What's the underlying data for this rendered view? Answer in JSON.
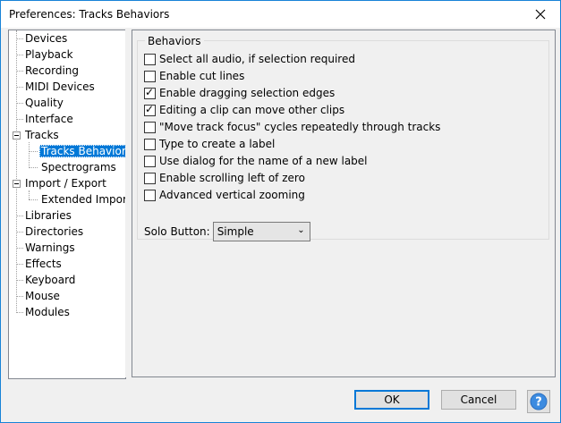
{
  "window": {
    "title": "Preferences: Tracks Behaviors",
    "close_icon": "close-icon"
  },
  "tree": {
    "items": [
      {
        "label": "Devices"
      },
      {
        "label": "Playback"
      },
      {
        "label": "Recording"
      },
      {
        "label": "MIDI Devices"
      },
      {
        "label": "Quality"
      },
      {
        "label": "Interface"
      },
      {
        "label": "Tracks"
      },
      {
        "label": "Tracks Behaviors"
      },
      {
        "label": "Spectrograms"
      },
      {
        "label": "Import / Export"
      },
      {
        "label": "Extended Import"
      },
      {
        "label": "Libraries"
      },
      {
        "label": "Directories"
      },
      {
        "label": "Warnings"
      },
      {
        "label": "Effects"
      },
      {
        "label": "Keyboard"
      },
      {
        "label": "Mouse"
      },
      {
        "label": "Modules"
      }
    ],
    "selected": "Tracks Behaviors"
  },
  "behaviors": {
    "group_title": "Behaviors",
    "options": [
      {
        "label": "Select all audio, if selection required",
        "checked": false
      },
      {
        "label": "Enable cut lines",
        "checked": false
      },
      {
        "label": "Enable dragging selection edges",
        "checked": true
      },
      {
        "label": "Editing a clip can move other clips",
        "checked": true
      },
      {
        "label": "\"Move track focus\" cycles repeatedly through tracks",
        "checked": false
      },
      {
        "label": "Type to create a label",
        "checked": false
      },
      {
        "label": "Use dialog for the name of a new label",
        "checked": false
      },
      {
        "label": "Enable scrolling left of zero",
        "checked": false
      },
      {
        "label": "Advanced vertical zooming",
        "checked": false
      }
    ],
    "solo_label": "Solo Button:",
    "solo_value": "Simple"
  },
  "buttons": {
    "ok": "OK",
    "cancel": "Cancel",
    "help": "?"
  },
  "colors": {
    "selection": "#0078d7",
    "border_accent": "#1883d7"
  }
}
